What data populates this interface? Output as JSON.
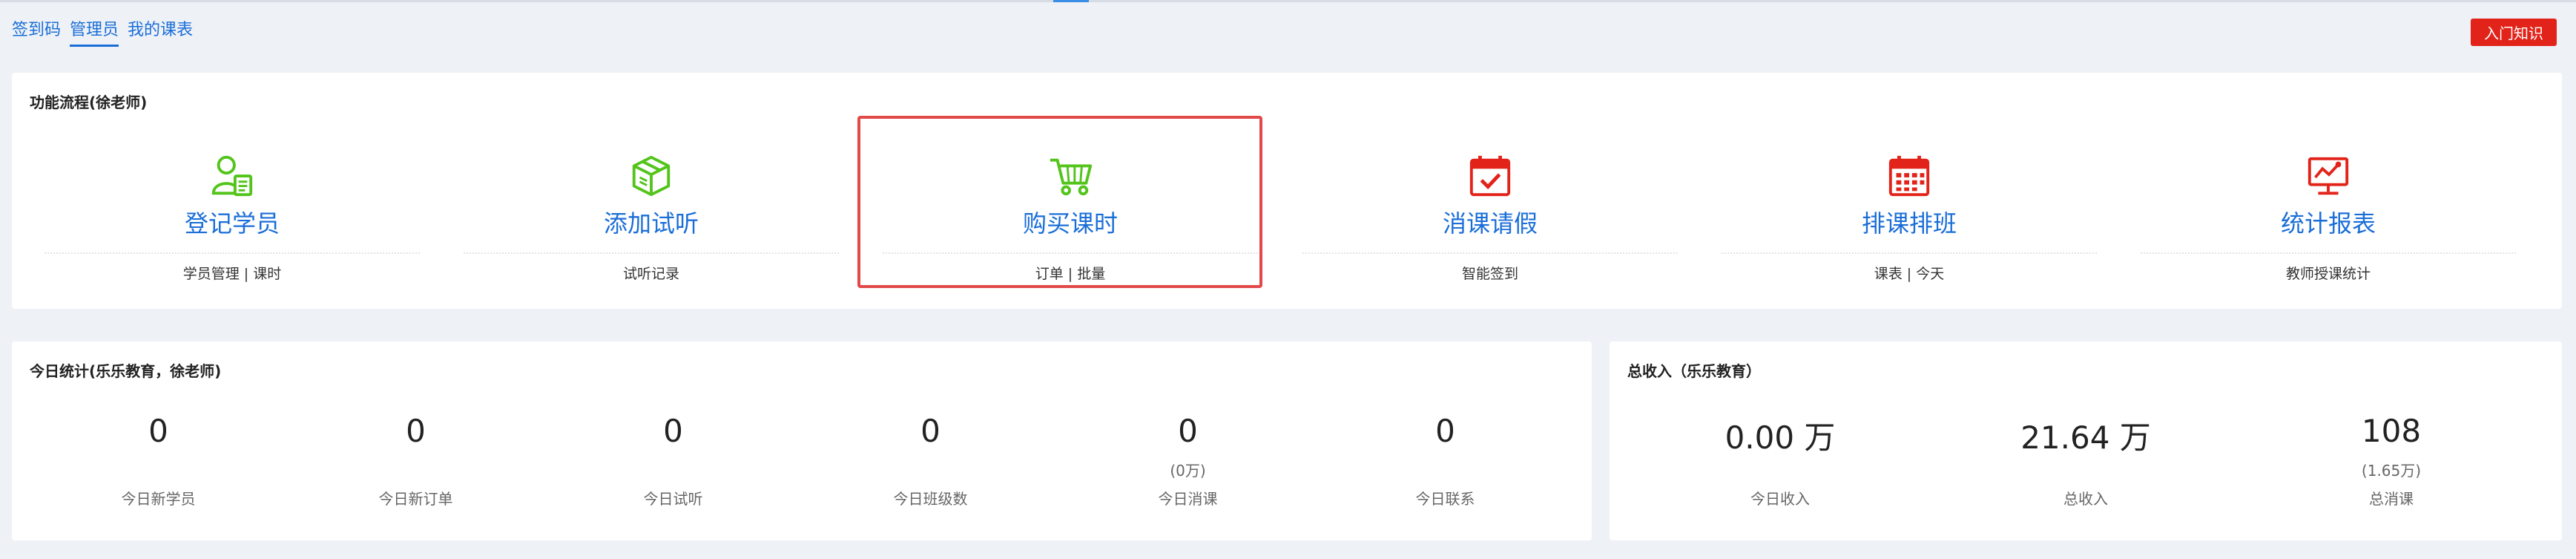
{
  "nav": {
    "tabs": [
      {
        "label": "签到码"
      },
      {
        "label": "管理员",
        "active": true
      },
      {
        "label": "我的课表"
      }
    ]
  },
  "header": {
    "intro_button": "入门知识"
  },
  "colors": {
    "primary": "#1a6ed8",
    "green": "#52c41a",
    "red": "#e2231a",
    "highlight": "#e24a4a"
  },
  "flow": {
    "title": "功能流程(徐老师)",
    "items": [
      {
        "label": "登记学员",
        "sub": "学员管理 | 课时",
        "icon": "user-register-icon"
      },
      {
        "label": "添加试听",
        "sub": "试听记录",
        "icon": "box-icon"
      },
      {
        "label": "购买课时",
        "sub": "订单 | 批量",
        "icon": "shopping-cart-icon",
        "highlighted": true
      },
      {
        "label": "消课请假",
        "sub": "智能签到",
        "icon": "calendar-check-icon"
      },
      {
        "label": "排课排班",
        "sub": "课表 | 今天",
        "icon": "calendar-grid-icon"
      },
      {
        "label": "统计报表",
        "sub": "教师授课统计",
        "icon": "chart-monitor-icon"
      }
    ]
  },
  "today": {
    "title": "今日统计(乐乐教育，徐老师)",
    "stats": [
      {
        "value": "0",
        "sub": "",
        "label": "今日新学员"
      },
      {
        "value": "0",
        "sub": "",
        "label": "今日新订单"
      },
      {
        "value": "0",
        "sub": "",
        "label": "今日试听"
      },
      {
        "value": "0",
        "sub": "",
        "label": "今日班级数"
      },
      {
        "value": "0",
        "sub": "(0万)",
        "label": "今日消课"
      },
      {
        "value": "0",
        "sub": "",
        "label": "今日联系"
      }
    ]
  },
  "income": {
    "title": "总收入（乐乐教育）",
    "stats": [
      {
        "value": "0.00 万",
        "sub": "",
        "label": "今日收入"
      },
      {
        "value": "21.64 万",
        "sub": "",
        "label": "总收入"
      },
      {
        "value": "108",
        "sub": "(1.65万)",
        "label": "总消课"
      }
    ]
  }
}
